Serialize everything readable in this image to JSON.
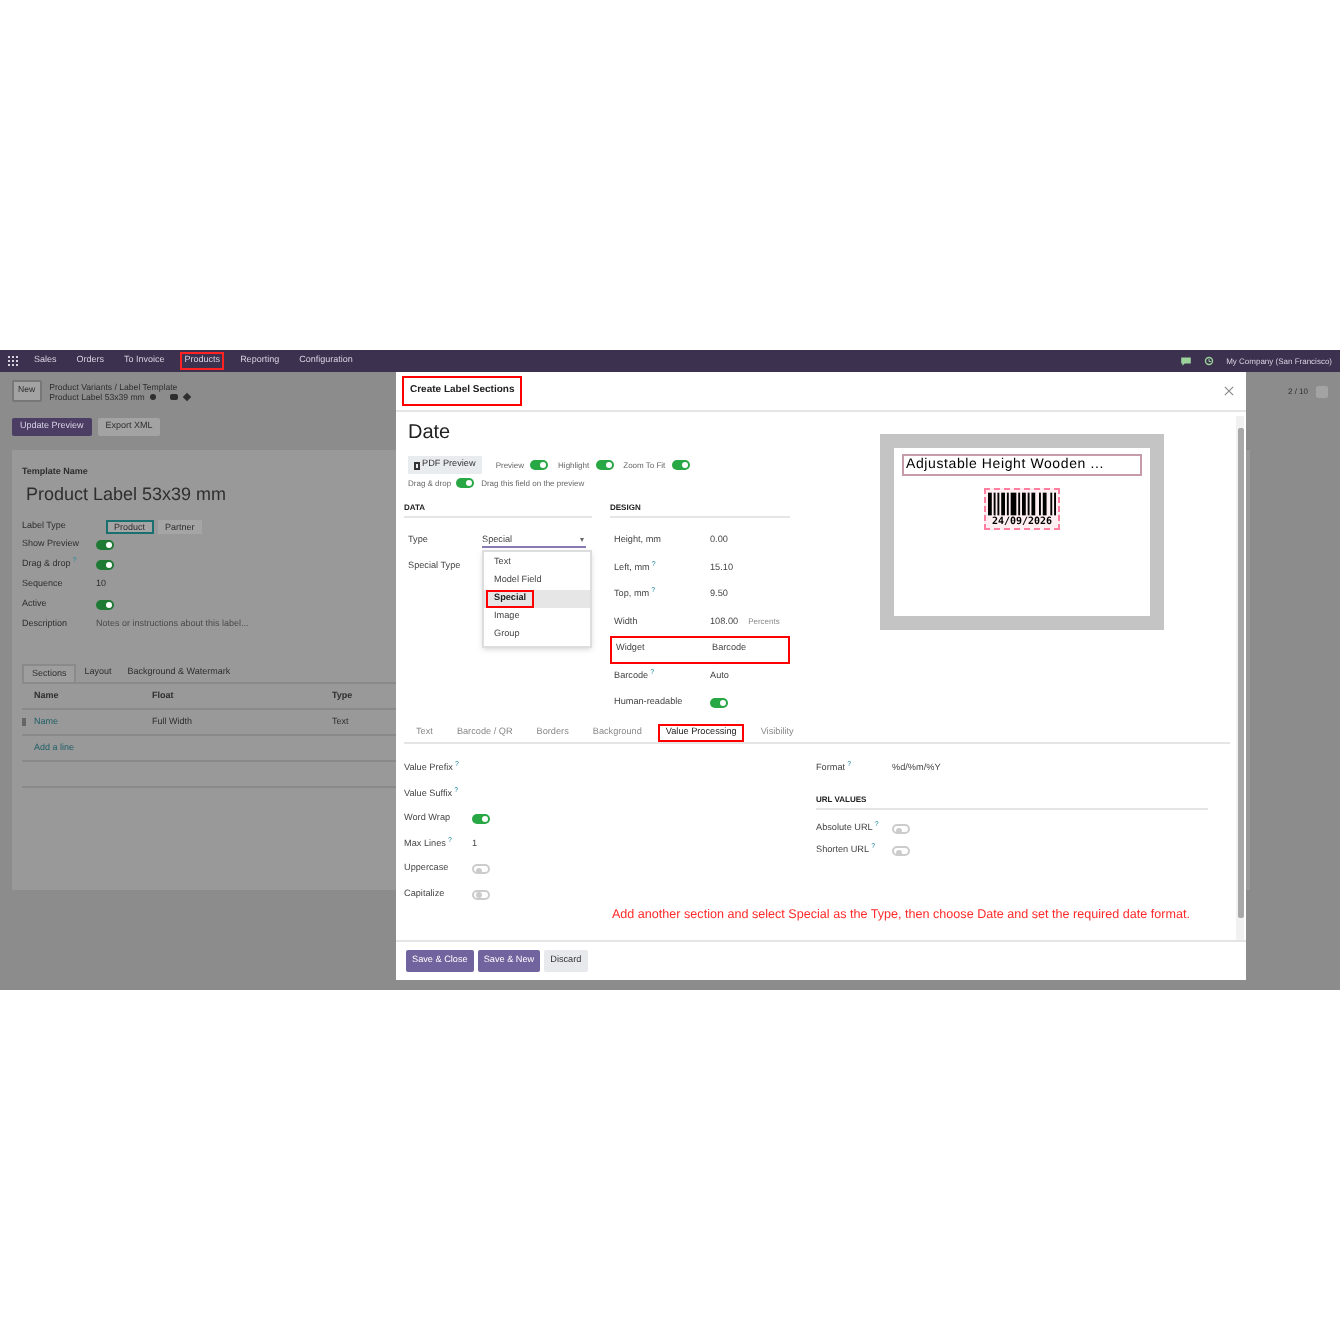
{
  "navbar": {
    "items": [
      {
        "label": "Sales",
        "highlighted": false
      },
      {
        "label": "Orders",
        "highlighted": false
      },
      {
        "label": "To Invoice",
        "highlighted": false
      },
      {
        "label": "Products",
        "highlighted": true
      },
      {
        "label": "Reporting",
        "highlighted": false
      },
      {
        "label": "Configuration",
        "highlighted": false
      }
    ],
    "company": "My Company (San Francisco)"
  },
  "breadcrumb": {
    "new_button": "New",
    "path": "Product Variants / Label Template",
    "record": "Product Label 53x39 mm",
    "pager": "2 / 10"
  },
  "actions": [
    {
      "label": "Update Preview",
      "kind": "primary"
    },
    {
      "label": "Export XML",
      "kind": "secondary"
    }
  ],
  "form": {
    "template_name_label": "Template Name",
    "template_name": "Product Label 53x39 mm",
    "label_type": "Label Type",
    "label_type_options": [
      {
        "label": "Product",
        "selected": true
      },
      {
        "label": "Partner",
        "selected": false
      }
    ],
    "fields": [
      {
        "kind": "toggle",
        "label": "Show Preview",
        "on": true
      },
      {
        "kind": "toggle",
        "label": "Drag & drop",
        "help": "?",
        "on": true
      },
      {
        "kind": "text",
        "label": "Sequence",
        "value": "10"
      },
      {
        "kind": "toggle",
        "label": "Active",
        "on": true
      },
      {
        "kind": "placeholder",
        "label": "Description",
        "placeholder": "Notes or instructions about this label..."
      }
    ],
    "tabs": [
      {
        "label": "Sections",
        "selected": true
      },
      {
        "label": "Layout",
        "selected": false
      },
      {
        "label": "Background & Watermark",
        "selected": false
      }
    ],
    "columns": [
      "Name",
      "Float",
      "Type"
    ],
    "rows": [
      [
        "Name",
        "Full Width",
        "Text"
      ]
    ],
    "add_line": "Add a line"
  },
  "dialog": {
    "title": "Create Label Sections",
    "title_highlighted": true,
    "heading": "Date",
    "pdf_button": "PDF Preview",
    "toggles": [
      {
        "label": "Preview",
        "on": true
      },
      {
        "label": "Highlight",
        "on": true
      },
      {
        "label": "Zoom To Fit",
        "on": true
      }
    ],
    "drag": {
      "label": "Drag & drop",
      "on": true,
      "hint": "Drag this field on the preview"
    },
    "preview": {
      "title": "Adjustable Height Wooden ...",
      "barcode_text": "24/09/2026"
    },
    "data_heading": "DATA",
    "type_label": "Type",
    "type_value": "Special",
    "special_type_label": "Special Type",
    "type_options": [
      {
        "label": "Text",
        "selected": false,
        "highlighted": false
      },
      {
        "label": "Model Field",
        "selected": false,
        "highlighted": false
      },
      {
        "label": "Special",
        "selected": true,
        "highlighted": true
      },
      {
        "label": "Image",
        "selected": false,
        "highlighted": false
      },
      {
        "label": "Group",
        "selected": false,
        "highlighted": false
      }
    ],
    "design_heading": "DESIGN",
    "design_fields": [
      {
        "kind": "text",
        "label": "Height, mm",
        "value": "0.00"
      },
      {
        "kind": "text",
        "label": "Left, mm",
        "help": "?",
        "value": "15.10"
      },
      {
        "kind": "text",
        "label": "Top, mm",
        "help": "?",
        "value": "9.50"
      },
      {
        "kind": "text",
        "label": "Width",
        "value": "108.00",
        "unit": "Percents"
      },
      {
        "kind": "text",
        "label": "Widget",
        "value": "Barcode",
        "highlighted": true
      },
      {
        "kind": "text",
        "label": "Barcode",
        "help": "?",
        "value": "Auto"
      },
      {
        "kind": "toggle",
        "label": "Human-readable",
        "on": true
      }
    ],
    "tabs": [
      {
        "label": "Text",
        "selected": false,
        "highlighted": false
      },
      {
        "label": "Barcode / QR",
        "selected": false,
        "highlighted": false
      },
      {
        "label": "Borders",
        "selected": false,
        "highlighted": false
      },
      {
        "label": "Background",
        "selected": false,
        "highlighted": false
      },
      {
        "label": "Value Processing",
        "selected": true,
        "highlighted": true
      },
      {
        "label": "Visibility",
        "selected": false,
        "highlighted": false
      }
    ],
    "left_fields": [
      {
        "kind": "blank",
        "label": "Value Prefix",
        "help": "?"
      },
      {
        "kind": "blank",
        "label": "Value Suffix",
        "help": "?"
      },
      {
        "kind": "toggle",
        "label": "Word Wrap",
        "on": true
      },
      {
        "kind": "text",
        "label": "Max Lines",
        "help": "?",
        "value": "1"
      },
      {
        "kind": "toggle",
        "label": "Uppercase",
        "on": false
      },
      {
        "kind": "toggle",
        "label": "Capitalize",
        "on": false
      }
    ],
    "format": {
      "kind": "text",
      "label": "Format",
      "help": "?",
      "value": "%d/%m/%Y"
    },
    "url_heading": "URL VALUES",
    "url_fields": [
      {
        "kind": "toggle",
        "label": "Absolute URL",
        "help": "?",
        "on": false
      },
      {
        "kind": "toggle",
        "label": "Shorten URL",
        "help": "?",
        "on": false
      }
    ],
    "note": "Add another section and select Special as the Type, then choose Date and set the required date format.",
    "buttons": [
      {
        "label": "Save & Close",
        "kind": "primary"
      },
      {
        "label": "Save & New",
        "kind": "primary"
      },
      {
        "label": "Discard",
        "kind": "secondary"
      }
    ]
  }
}
